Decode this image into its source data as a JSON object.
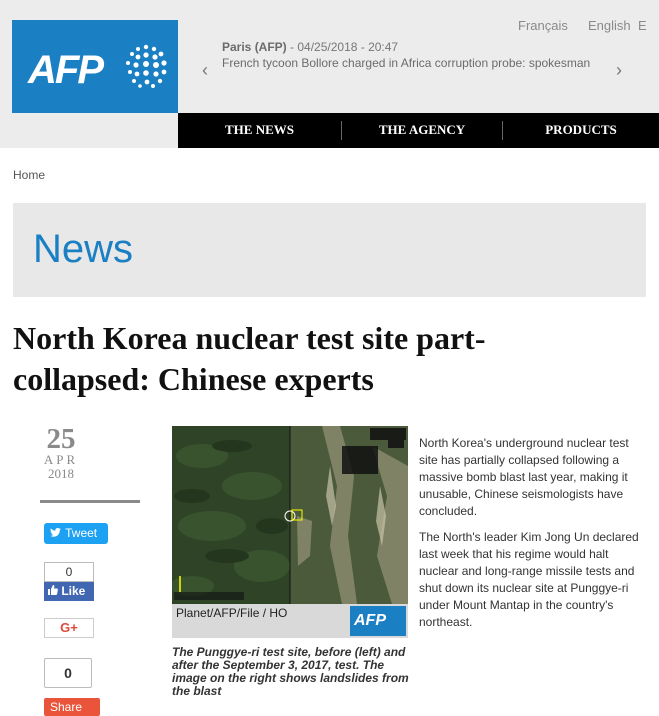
{
  "header": {
    "logo_text": "AFP",
    "languages": [
      "Français",
      "English",
      "E"
    ],
    "ticker": {
      "source": "Paris (AFP)",
      "timestamp": " - 04/25/2018 - 20:47",
      "headline": "French tycoon Bollore charged in Africa corruption probe: spokesman",
      "prev": "‹",
      "next": "›"
    },
    "nav": [
      "THE NEWS",
      "THE AGENCY",
      "PRODUCTS"
    ]
  },
  "breadcrumb": "Home",
  "section_title": "News",
  "article": {
    "headline": "North Korea nuclear test site part-collapsed: Chinese experts",
    "date": {
      "day": "25",
      "month": "APR",
      "year": "2018"
    },
    "photo": {
      "credit": "Planet/AFP/File / HO",
      "credit_logo": "AFP",
      "caption": "The Punggye-ri test site, before (left) and after the September 3, 2017, test. The image on the right shows landslides from the blast"
    },
    "paragraphs": [
      "North Korea's underground nuclear test site has partially collapsed following a massive bomb blast last year, making it unusable, Chinese seismologists have concluded.",
      "The North's leader Kim Jong Un declared last week that his regime would halt nuclear and long-range missile tests and shut down its nuclear site at Punggye-ri under Mount Mantap in the country's northeast."
    ]
  },
  "social": {
    "tweet_label": "Tweet",
    "fb_count": "0",
    "fb_label": "Like",
    "gplus_label": "G+",
    "share_count": "0",
    "share_label": "Share"
  },
  "colors": {
    "brand_blue": "#1a7fc3",
    "nav_black": "#000000",
    "twitter": "#1da1f2",
    "facebook": "#4267b2"
  }
}
